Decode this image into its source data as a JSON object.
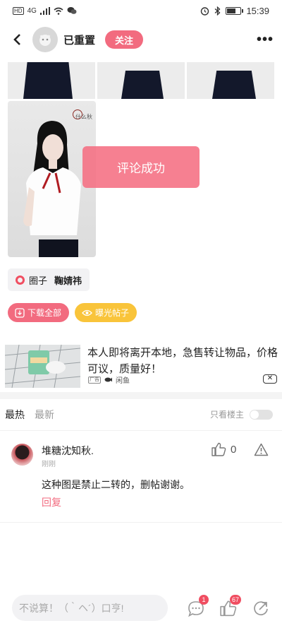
{
  "status_bar": {
    "network": "HD",
    "signal": "4G",
    "time": "15:39",
    "battery_level": 0.65
  },
  "header": {
    "nickname": "已重置",
    "follow_label": "关注"
  },
  "post": {
    "photo_seal_text": "什么秋",
    "toast": "评论成功",
    "circle": {
      "label": "圈子",
      "name": "鞠婧祎"
    },
    "download_label": "下载全部",
    "expose_label": "曝光帖子"
  },
  "ad": {
    "title": "本人即将离开本地，急售转让物品，价格可议，质量好！",
    "badge": "广告",
    "source": "闲鱼",
    "close_symbol": "✕"
  },
  "comments_section": {
    "tabs": [
      "最热",
      "最新"
    ],
    "active_tab": 0,
    "owner_only_label": "只看楼主",
    "owner_only_on": false,
    "comments": [
      {
        "user": "堆糖沈知秋.",
        "time": "刚刚",
        "likes": "0",
        "text": "这种图是禁止二转的，删帖谢谢。",
        "reply_label": "回复"
      }
    ]
  },
  "bottom_bar": {
    "input_placeholder": "不说算！（｀ヘ´）口亨!",
    "comment_count": "1",
    "like_count": "67"
  },
  "colors": {
    "accent": "#f26b7f",
    "yellow": "#f9c43a",
    "skirt": "#13182b"
  }
}
